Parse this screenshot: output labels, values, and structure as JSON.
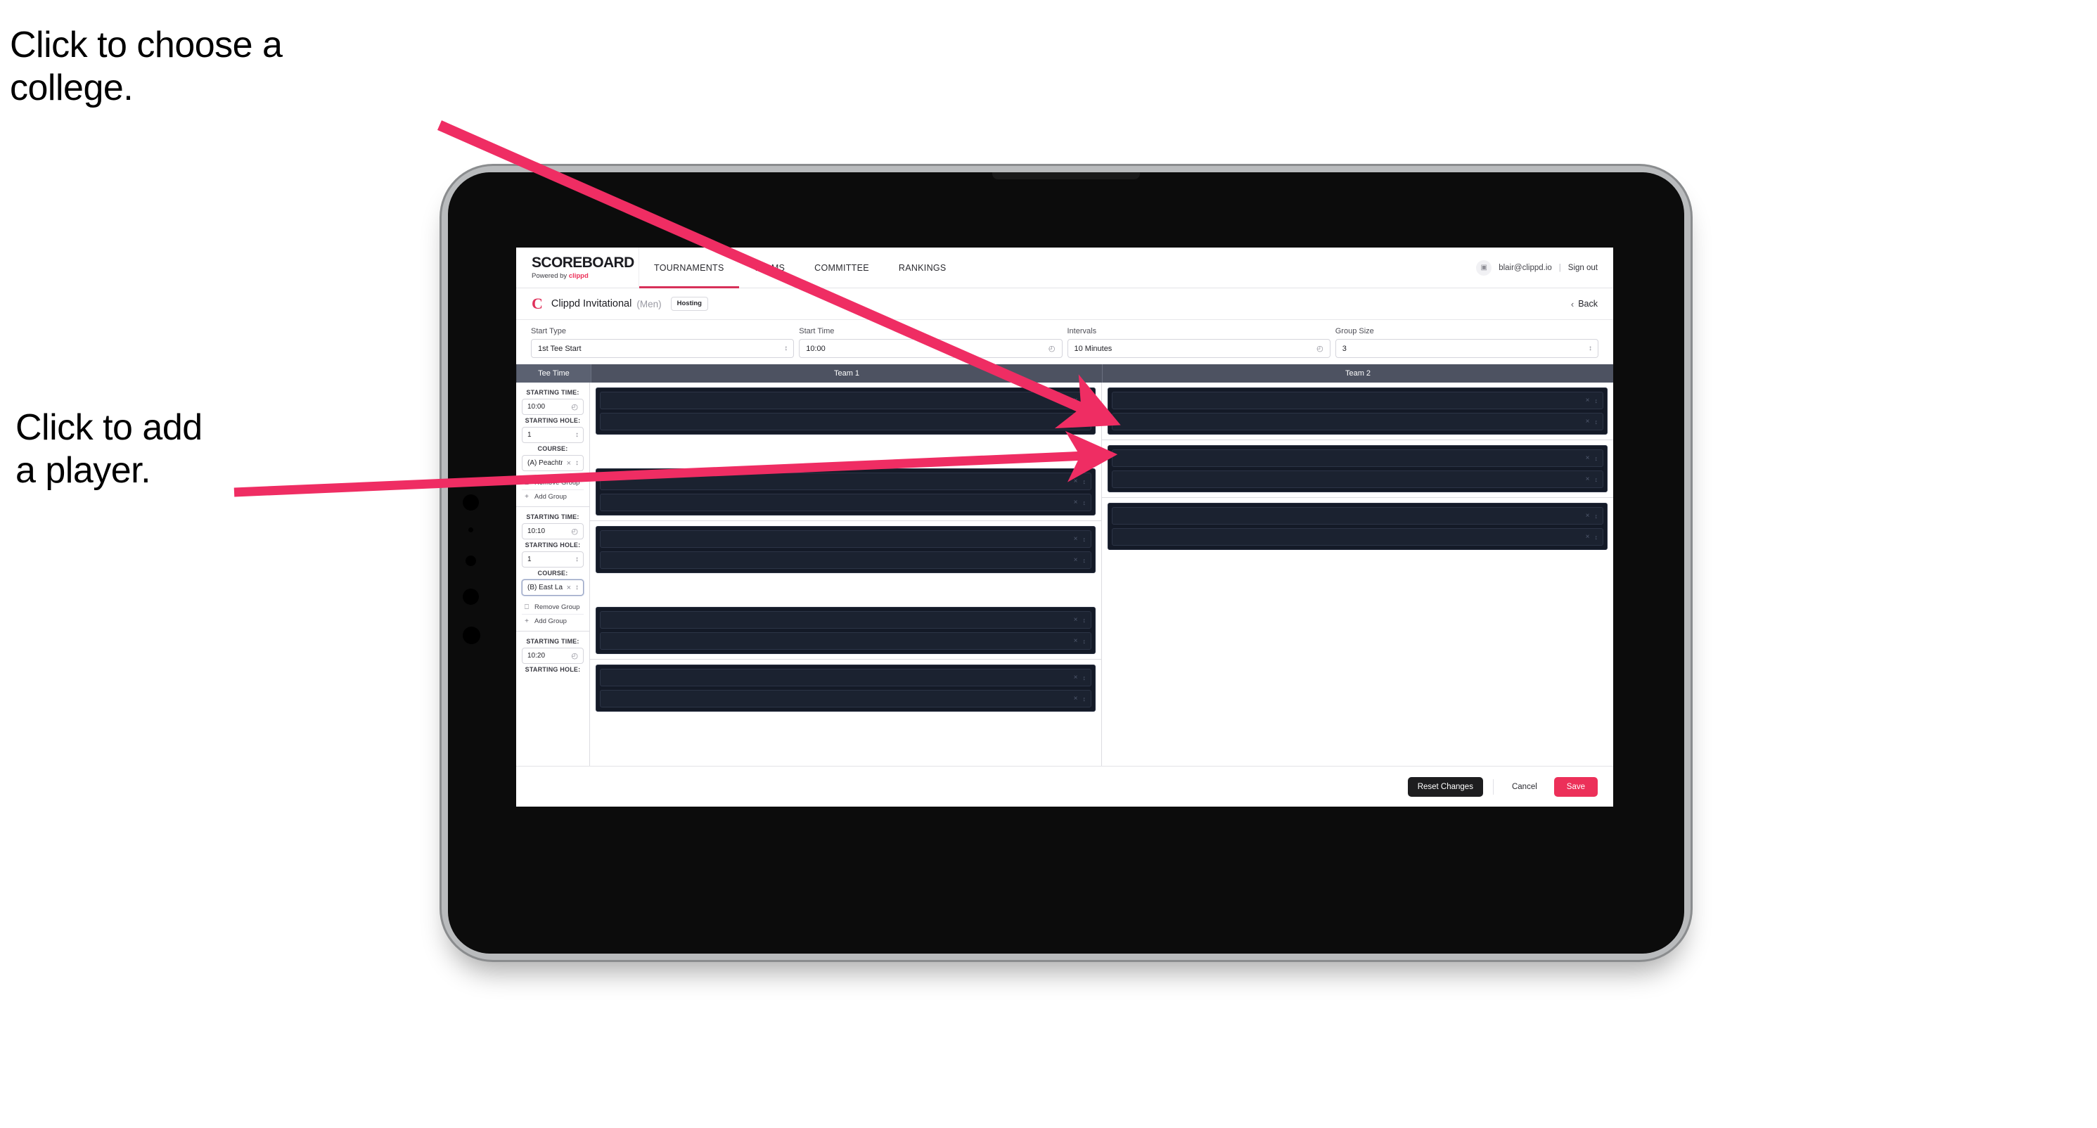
{
  "annotations": {
    "college": "Click to choose a\ncollege.",
    "player": "Click to add\na player."
  },
  "colors": {
    "accent_pink": "#ec3059",
    "arrow_pink": "#ef2d63",
    "nav_underline": "#d7315a",
    "table_header": "#4d5261",
    "slot_dark": "#141a27"
  },
  "header": {
    "brand_title": "SCOREBOARD",
    "brand_sub_prefix": "Powered by ",
    "brand_sub_accent": "clippd",
    "nav": [
      {
        "label": "TOURNAMENTS",
        "active": true
      },
      {
        "label": "TEAMS",
        "active": false
      },
      {
        "label": "COMMITTEE",
        "active": false
      },
      {
        "label": "RANKINGS",
        "active": false
      }
    ],
    "avatar_icon": "user-avatar-icon",
    "user_email": "blair@clippd.io",
    "separator": "|",
    "sign_out": "Sign out"
  },
  "title_row": {
    "logo_glyph": "C",
    "tournament_name": "Clippd Invitational",
    "gender": "(Men)",
    "badge": "Hosting",
    "back_chevron": "‹",
    "back_label": "Back"
  },
  "controls": [
    {
      "label": "Start Type",
      "value": "1st Tee Start",
      "icon": "stepper-icon"
    },
    {
      "label": "Start Time",
      "value": "10:00",
      "icon": "clock-icon"
    },
    {
      "label": "Intervals",
      "value": "10 Minutes",
      "icon": "clock-icon"
    },
    {
      "label": "Group Size",
      "value": "3",
      "icon": "stepper-icon"
    }
  ],
  "table": {
    "columns": [
      "Tee Time",
      "Team 1",
      "Team 2"
    ],
    "labels": {
      "starting_time": "STARTING TIME:",
      "starting_hole": "STARTING HOLE:",
      "course": "COURSE:",
      "remove_group": "Remove Group",
      "add_group": "Add Group"
    },
    "rows": [
      {
        "starting_time": "10:00",
        "starting_hole": "1",
        "course": "(A) Peachtree GC",
        "course_focused": false,
        "team1_panels": [
          {
            "slots": [
              "",
              ""
            ]
          },
          {
            "slots": [
              "",
              ""
            ]
          }
        ],
        "team2_panels": [
          {
            "slots": [
              "",
              ""
            ]
          }
        ]
      },
      {
        "starting_time": "10:10",
        "starting_hole": "1",
        "course": "(B) East Lake GC",
        "course_focused": true,
        "team1_panels": [
          {
            "slots": [
              "",
              ""
            ]
          },
          {
            "slots": [
              "",
              ""
            ]
          }
        ],
        "team2_panels": [
          {
            "slots": [
              "",
              ""
            ]
          }
        ]
      },
      {
        "starting_time": "10:20",
        "starting_hole": "",
        "course": "",
        "course_focused": false,
        "team1_panels": [
          {
            "slots": [
              "",
              ""
            ]
          }
        ],
        "team2_panels": [
          {
            "slots": [
              "",
              ""
            ]
          }
        ]
      }
    ],
    "slot_icons": {
      "clear": "×",
      "stepper": "⌃⌄"
    }
  },
  "footer": {
    "reset_label": "Reset Changes",
    "cancel_label": "Cancel",
    "save_label": "Save"
  }
}
